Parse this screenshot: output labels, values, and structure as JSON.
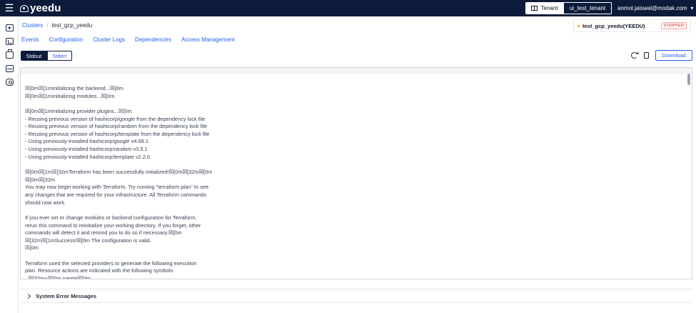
{
  "app": {
    "logo_text": "yeedu",
    "menu_icon": "hamburger-icon"
  },
  "header": {
    "tenant_label": "Tenant",
    "tenant_name": "ui_test_tenant",
    "user_email": "anmol.jaiswal@modak.com",
    "user_chevron": "▾"
  },
  "sidebar": {
    "items": [
      {
        "icon": "play-icon"
      },
      {
        "icon": "chart-icon"
      },
      {
        "icon": "briefcase-icon"
      },
      {
        "icon": "film-icon"
      },
      {
        "icon": "cloud-icon"
      }
    ]
  },
  "breadcrumb": {
    "root": "Clusters",
    "separator": "/",
    "current": "test_gcp_yeedu"
  },
  "cluster_status": {
    "name": "test_gcp_yeedu(YEEDU)",
    "state": "STOPPED",
    "dot_color": "#f59e0b"
  },
  "tabs": [
    "Events",
    "Configuration",
    "Cluster Logs",
    "Dependencies",
    "Access Management"
  ],
  "log_toggle": {
    "stdout": "Stdout",
    "stderr": "Stderr"
  },
  "actions": {
    "refresh_icon": "refresh-icon",
    "copy_icon": "copy-icon",
    "download": "Download"
  },
  "log_lines": [
    "\u001b[0m\u001b[1mInitializing the backend...\u001b[0m",
    "\u001b[0m\u001b[1mInitializing modules...\u001b[0m",
    "",
    "\u001b[0m\u001b[1mInitializing provider plugins...\u001b[0m",
    "- Reusing previous version of hashicorp/google from the dependency lock file",
    "- Reusing previous version of hashicorp/random from the dependency lock file",
    "- Reusing previous version of hashicorp/template from the dependency lock file",
    "- Using previously-installed hashicorp/google v4.69.1",
    "- Using previously-installed hashicorp/random v3.5.1",
    "- Using previously-installed hashicorp/template v2.2.0",
    "",
    "\u001b[0m\u001b[1m\u001b[32mTerraform has been successfully initialized!\u001b[0m\u001b[32m\u001b[0m",
    "\u001b[0m\u001b[32m",
    "You may now begin working with Terraform. Try running \"terraform plan\" to see",
    "any changes that are required for your infrastructure. All Terraform commands",
    "should now work.",
    "",
    "If you ever set or change modules or backend configuration for Terraform,",
    "rerun this command to reinitialize your working directory. If you forget, other",
    "commands will detect it and remind you to do so if necessary.\u001b[0m",
    "\u001b[32m\u001b[1mSuccess!\u001b[0m The configuration is valid.",
    "\u001b[0m",
    "",
    "Terraform used the selected providers to generate the following execution",
    "plan. Resource actions are indicated with the following symbols:",
    "  \u001b[32m+\u001b[0m create\u001b[0m"
  ],
  "system_errors": {
    "label": "System Error Messages"
  }
}
